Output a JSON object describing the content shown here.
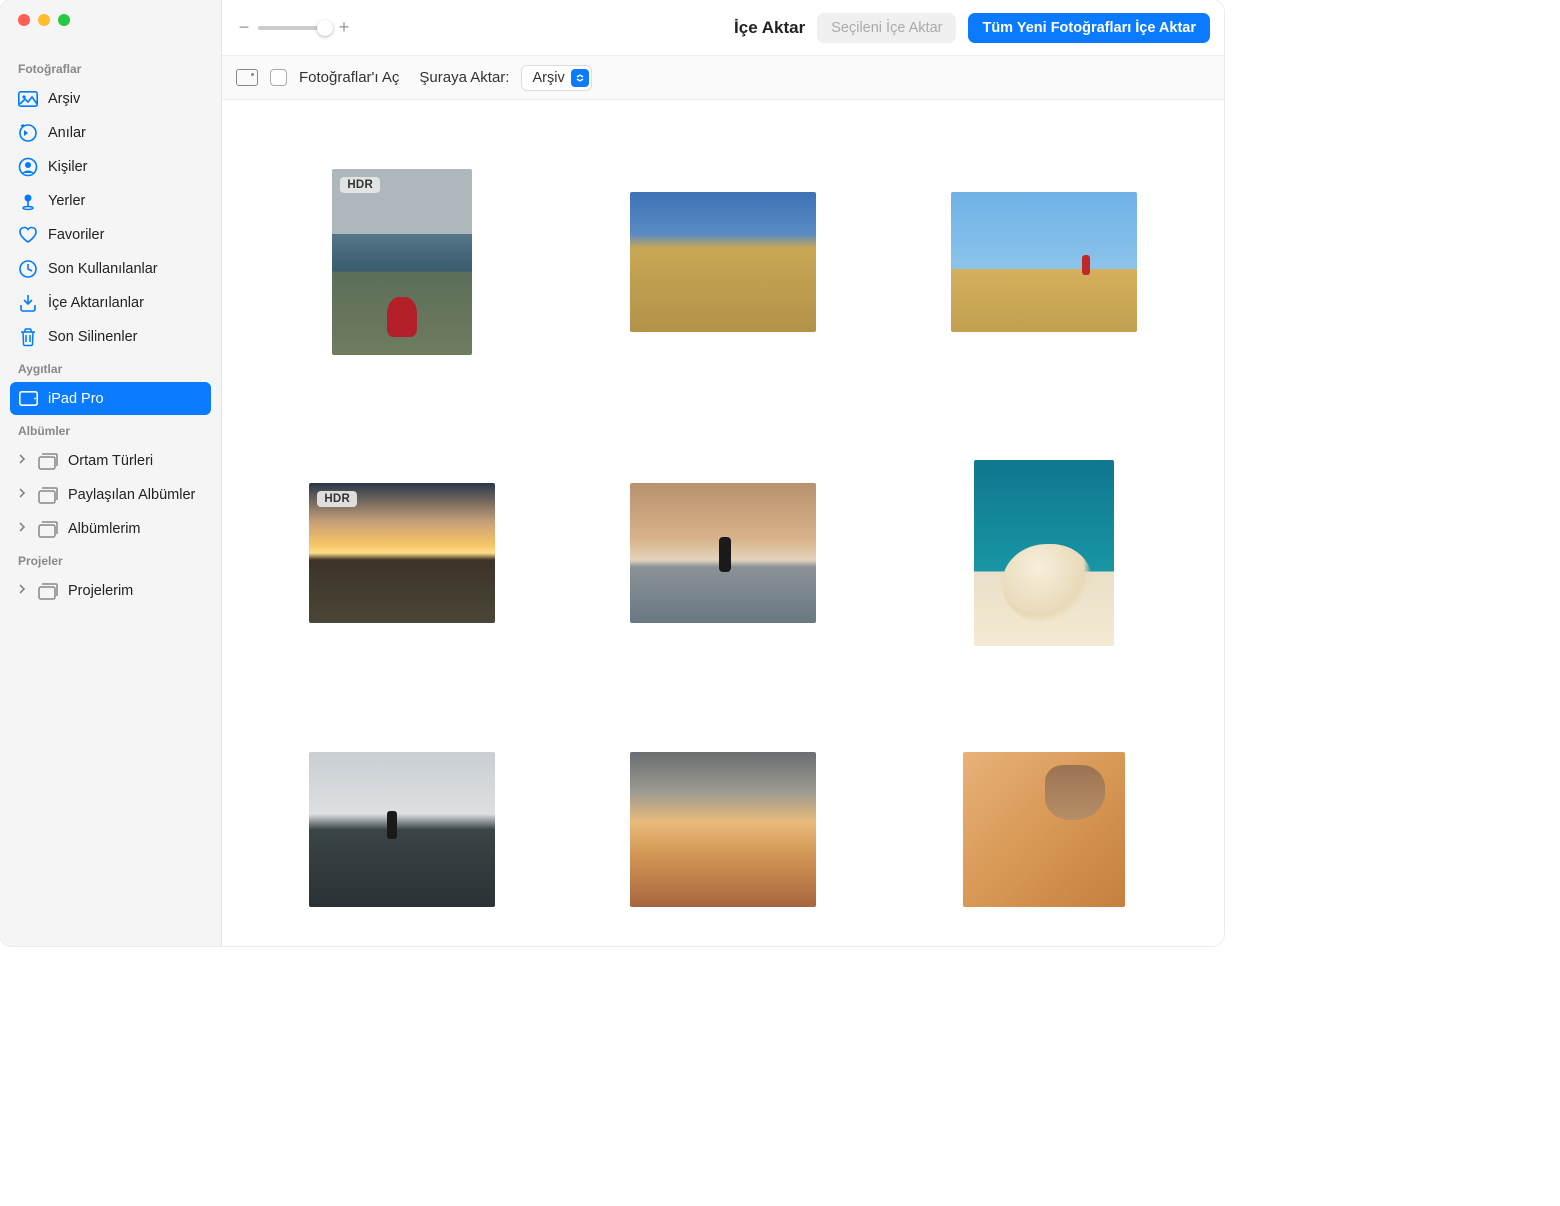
{
  "toolbar": {
    "title": "İçe Aktar",
    "import_selected": "Seçileni İçe Aktar",
    "import_all": "Tüm Yeni Fotoğrafları İçe Aktar",
    "zoom_minus": "−",
    "zoom_plus": "+"
  },
  "subtoolbar": {
    "open_photos_label": "Fotoğraflar'ı Aç",
    "import_to_label": "Şuraya Aktar:",
    "import_to_value": "Arşiv"
  },
  "sidebar": {
    "sections": {
      "photos": "Fotoğraflar",
      "devices": "Aygıtlar",
      "albums": "Albümler",
      "projects": "Projeler"
    },
    "photos_items": [
      {
        "label": "Arşiv",
        "icon": "library"
      },
      {
        "label": "Anılar",
        "icon": "memories"
      },
      {
        "label": "Kişiler",
        "icon": "people"
      },
      {
        "label": "Yerler",
        "icon": "places"
      },
      {
        "label": "Favoriler",
        "icon": "heart"
      },
      {
        "label": "Son Kullanılanlar",
        "icon": "clock"
      },
      {
        "label": "İçe Aktarılanlar",
        "icon": "import"
      },
      {
        "label": "Son Silinenler",
        "icon": "trash"
      }
    ],
    "devices_items": [
      {
        "label": "iPad Pro",
        "icon": "ipad",
        "selected": true
      }
    ],
    "albums_items": [
      {
        "label": "Ortam Türleri",
        "icon": "stack",
        "disclosure": true
      },
      {
        "label": "Paylaşılan Albümler",
        "icon": "stack",
        "disclosure": true
      },
      {
        "label": "Albümlerim",
        "icon": "stack",
        "disclosure": true
      }
    ],
    "projects_items": [
      {
        "label": "Projelerim",
        "icon": "stack",
        "disclosure": true
      }
    ]
  },
  "grid": {
    "hdr_badge": "HDR",
    "photos": [
      {
        "badge": "HDR"
      },
      {
        "badge": null
      },
      {
        "badge": null
      },
      {
        "badge": "HDR"
      },
      {
        "badge": null
      },
      {
        "badge": null
      },
      {
        "badge": null
      },
      {
        "badge": null
      },
      {
        "badge": null
      }
    ]
  }
}
